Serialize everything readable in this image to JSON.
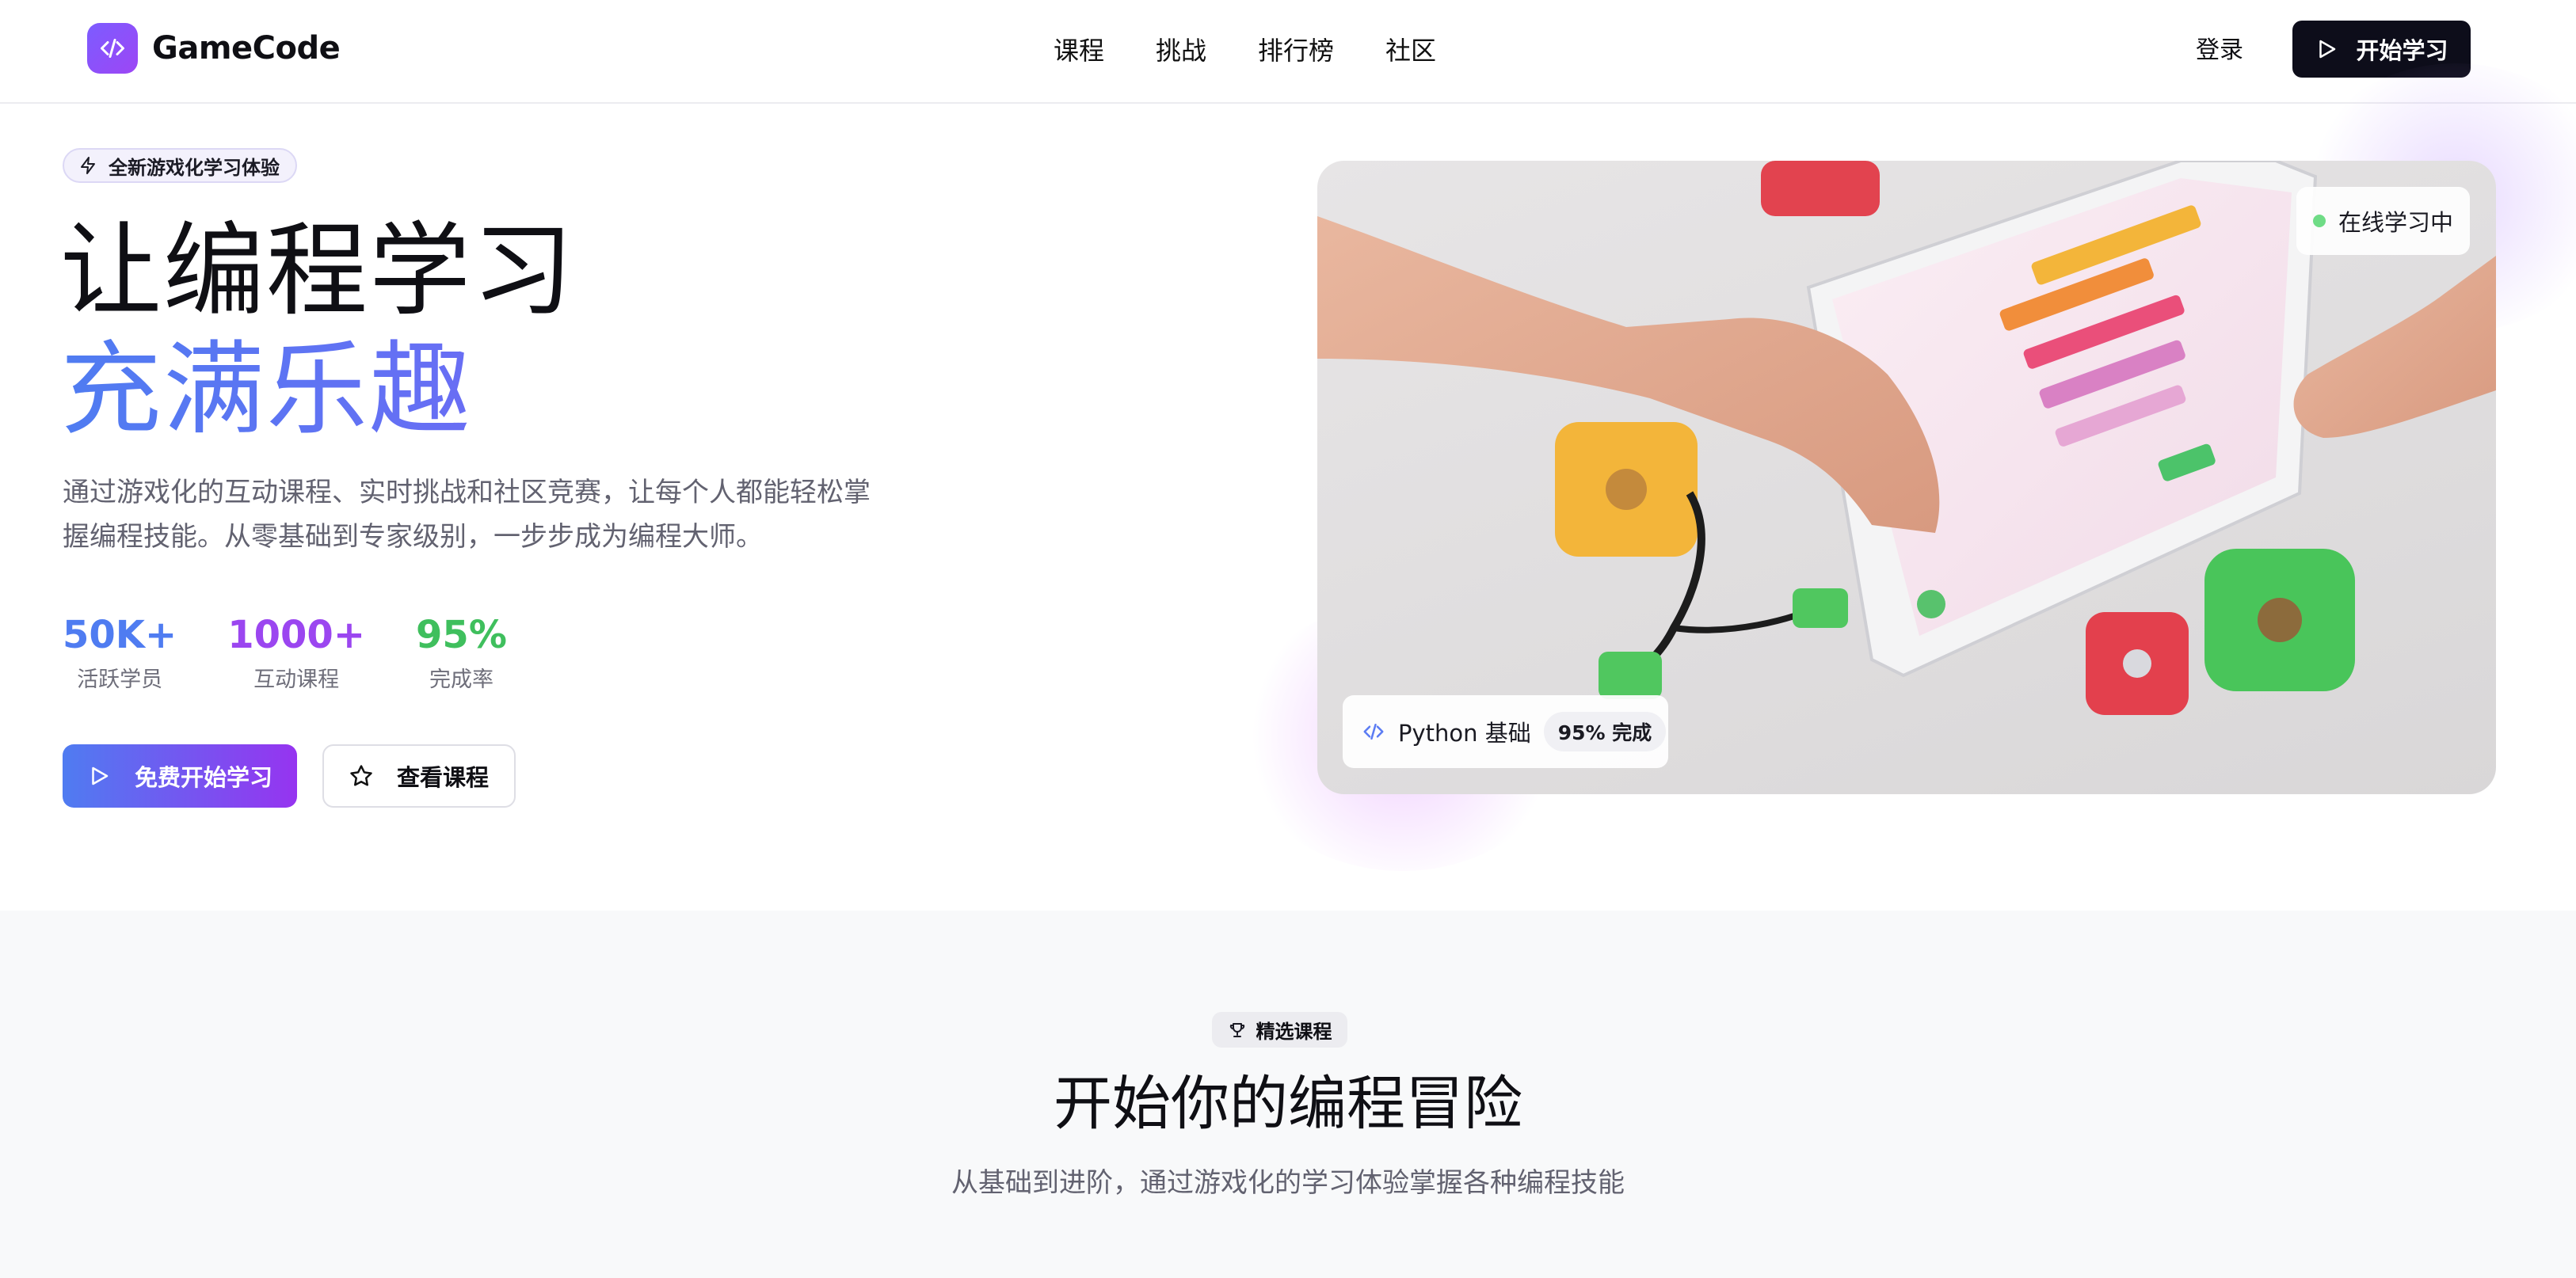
{
  "brand": {
    "name": "GameCode",
    "accent": "#7c5cff"
  },
  "nav": {
    "items": [
      {
        "label": "课程"
      },
      {
        "label": "挑战"
      },
      {
        "label": "排行榜"
      },
      {
        "label": "社区"
      }
    ],
    "login_label": "登录",
    "start_label": "开始学习"
  },
  "hero": {
    "badge": "全新游戏化学习体验",
    "title_line1": "让编程学习",
    "title_line2": "充满乐趣",
    "description": "通过游戏化的互动课程、实时挑战和社区竞赛，让每个人都能轻松掌握编程技能。从零基础到专家级别，一步步成为编程大师。",
    "stats": [
      {
        "value": "50K+",
        "label": "活跃学员",
        "color": "#4f7cf1"
      },
      {
        "value": "1000+",
        "label": "互动课程",
        "color": "#9b46f0"
      },
      {
        "value": "95%",
        "label": "完成率",
        "color": "#3fbf5d"
      }
    ],
    "primary_button": "免费开始学习",
    "secondary_button": "查看课程",
    "image": {
      "online_badge": "在线学习中",
      "course_name": "Python 基础",
      "course_progress": "95% 完成"
    }
  },
  "featured": {
    "badge": "精选课程",
    "title": "开始你的编程冒险",
    "subtitle": "从基础到进阶，通过游戏化的学习体验掌握各种编程技能"
  }
}
